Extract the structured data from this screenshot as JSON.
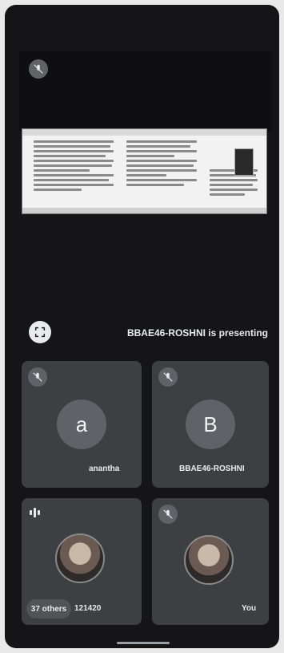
{
  "presentation": {
    "presenter_text": "BBAE46-ROSHNI is presenting",
    "fullscreen_icon": "fullscreen-icon"
  },
  "participants": [
    {
      "name": "anantha",
      "initial": "a",
      "mic": "muted"
    },
    {
      "name": "BBAE46-ROSHNI",
      "initial": "B",
      "mic": "muted"
    },
    {
      "name": "121420",
      "others": "37 others",
      "mic": "speaking"
    },
    {
      "name": "You",
      "mic": "muted"
    }
  ],
  "colors": {
    "tile": "#3c4043",
    "avatar": "#5f6368",
    "background": "#151518"
  }
}
